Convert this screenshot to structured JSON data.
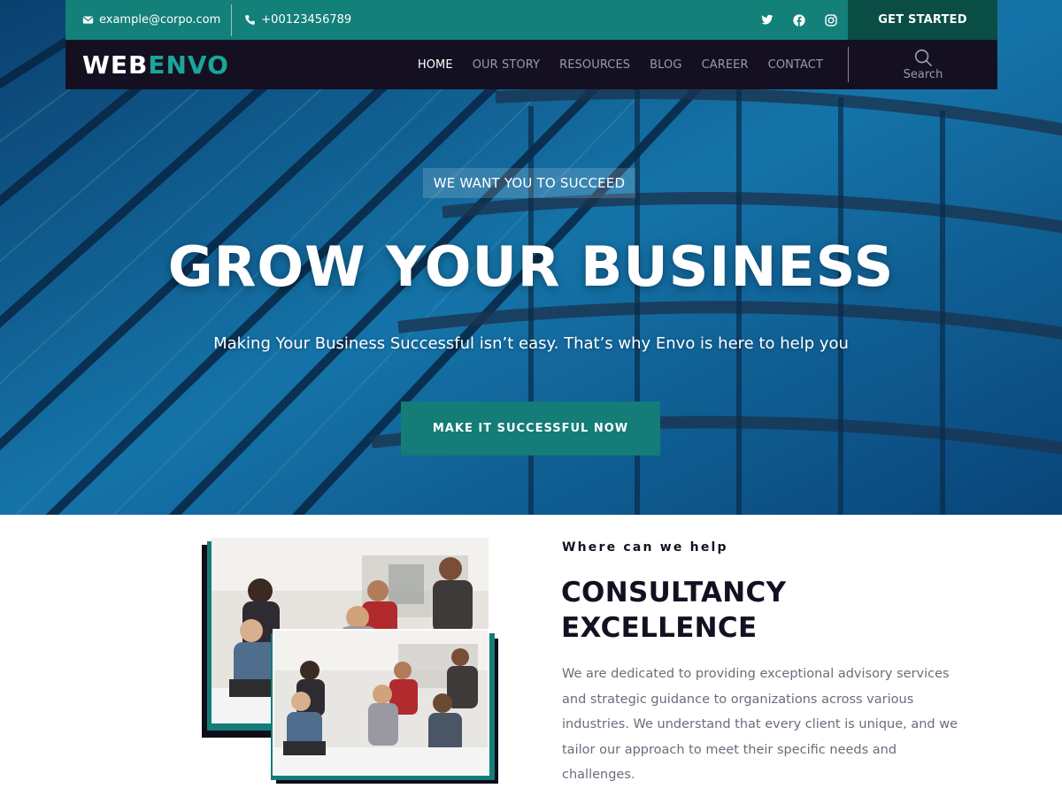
{
  "topbar": {
    "email": "example@corpo.com",
    "phone": "+00123456789",
    "social": [
      "twitter-icon",
      "facebook-icon",
      "instagram-icon"
    ],
    "cta_label": "GET STARTED"
  },
  "navbar": {
    "logo_part1": "WEB",
    "logo_part2": "ENVO",
    "links": [
      {
        "label": "HOME",
        "active": true
      },
      {
        "label": "OUR STORY",
        "active": false
      },
      {
        "label": "RESOURCES",
        "active": false
      },
      {
        "label": "BLOG",
        "active": false
      },
      {
        "label": "CAREER",
        "active": false
      },
      {
        "label": "CONTACT",
        "active": false
      }
    ],
    "search_label": "Search"
  },
  "hero": {
    "eyebrow": "WE WANT YOU TO SUCCEED",
    "title": "GROW YOUR BUSINESS",
    "subtitle": "Making Your Business Successful isn’t easy. That’s why Envo is here to help you",
    "cta_label": "MAKE IT SUCCESSFUL NOW"
  },
  "section": {
    "label": "Where can we help",
    "title_line1": "CONSULTANCY",
    "title_line2": "EXCELLENCE",
    "body": "We are dedicated to providing exceptional advisory services and strategic guidance to organizations across various industries. We understand that every client is unique, and we tailor our approach to meet their specific needs and challenges."
  },
  "colors": {
    "accent": "#147d77",
    "topbar": "#13807a",
    "navbar": "#141021",
    "get_started_bg": "#0a4d44",
    "heading": "#141021",
    "body_text": "#6d6b7b"
  }
}
